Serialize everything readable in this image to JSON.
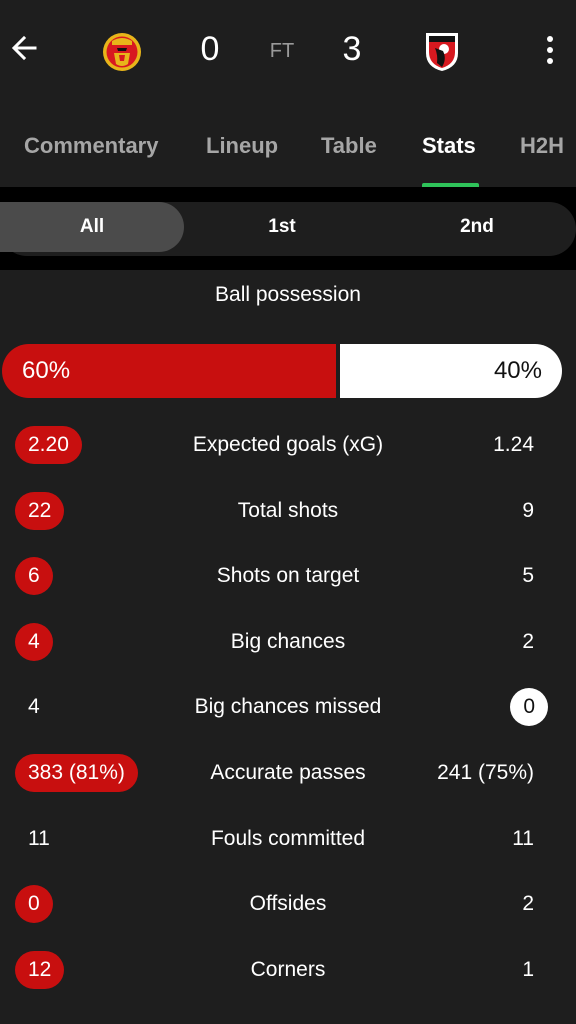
{
  "header": {
    "home_score": "0",
    "status": "FT",
    "away_score": "3",
    "home_crest_icon": "manchester-united-crest-icon",
    "away_crest_icon": "bournemouth-crest-icon"
  },
  "tabs": [
    {
      "label": "Commentary"
    },
    {
      "label": "Lineup"
    },
    {
      "label": "Table"
    },
    {
      "label": "Stats"
    },
    {
      "label": "H2H"
    }
  ],
  "active_tab": "Stats",
  "periods": [
    {
      "label": "All"
    },
    {
      "label": "1st"
    },
    {
      "label": "2nd"
    }
  ],
  "active_period": "All",
  "possession": {
    "title": "Ball possession",
    "home": "60%",
    "away": "40%",
    "home_fraction": 0.6
  },
  "stats": [
    {
      "name": "Expected goals (xG)",
      "home": "2.20",
      "away": "1.24",
      "highlight": "home"
    },
    {
      "name": "Total shots",
      "home": "22",
      "away": "9",
      "highlight": "home"
    },
    {
      "name": "Shots on target",
      "home": "6",
      "away": "5",
      "highlight": "home"
    },
    {
      "name": "Big chances",
      "home": "4",
      "away": "2",
      "highlight": "home"
    },
    {
      "name": "Big chances missed",
      "home": "4",
      "away": "0",
      "highlight": "away"
    },
    {
      "name": "Accurate passes",
      "home": "383 (81%)",
      "away": "241 (75%)",
      "highlight": "home"
    },
    {
      "name": "Fouls committed",
      "home": "11",
      "away": "11",
      "highlight": "none"
    },
    {
      "name": "Offsides",
      "home": "0",
      "away": "2",
      "highlight": "home"
    },
    {
      "name": "Corners",
      "home": "12",
      "away": "1",
      "highlight": "home"
    }
  ],
  "colors": {
    "home": "#c80f0f",
    "away": "#ffffff",
    "accent": "#2fc35a",
    "background": "#1e1e1e"
  }
}
